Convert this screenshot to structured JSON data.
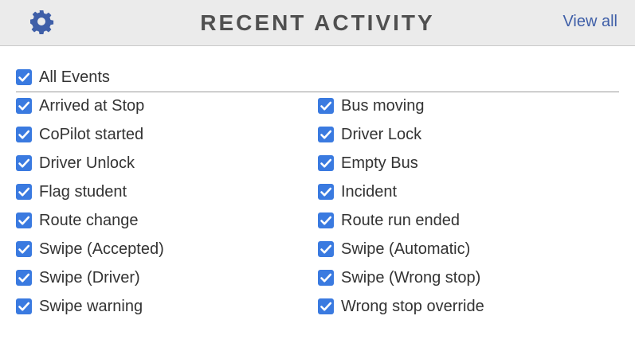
{
  "header": {
    "title": "RECENT ACTIVITY",
    "view_all_label": "View all",
    "settings_icon": "gear-icon"
  },
  "colors": {
    "accent": "#3a7ae0",
    "link": "#3f5fa8",
    "header_bg": "#ebebeb",
    "title_text": "#505050"
  },
  "all_events": {
    "label": "All Events",
    "checked": true
  },
  "left_column": [
    {
      "label": "Arrived at Stop",
      "checked": true
    },
    {
      "label": "CoPilot started",
      "checked": true
    },
    {
      "label": "Driver Unlock",
      "checked": true
    },
    {
      "label": "Flag student",
      "checked": true
    },
    {
      "label": "Route change",
      "checked": true
    },
    {
      "label": "Swipe (Accepted)",
      "checked": true
    },
    {
      "label": "Swipe (Driver)",
      "checked": true
    },
    {
      "label": "Swipe warning",
      "checked": true
    }
  ],
  "right_column": [
    {
      "label": "Bus moving",
      "checked": true
    },
    {
      "label": "Driver Lock",
      "checked": true
    },
    {
      "label": "Empty Bus",
      "checked": true
    },
    {
      "label": "Incident",
      "checked": true
    },
    {
      "label": "Route run ended",
      "checked": true
    },
    {
      "label": "Swipe (Automatic)",
      "checked": true
    },
    {
      "label": "Swipe (Wrong stop)",
      "checked": true
    },
    {
      "label": "Wrong stop override",
      "checked": true
    }
  ]
}
